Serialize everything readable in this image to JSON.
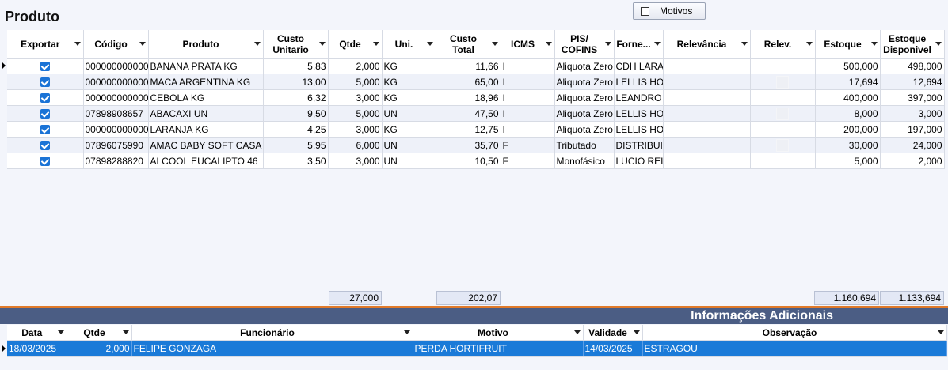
{
  "section_title": "Produto",
  "motivos_button": "Motivos",
  "columns": [
    "Exportar",
    "Código",
    "Produto",
    "Custo\nUnitario",
    "Qtde",
    "Uni.",
    "Custo\nTotal",
    "ICMS",
    "PIS/\nCOFINS",
    "Forne...",
    "Relevância",
    "Relev.",
    "Estoque",
    "Estoque\nDisponivel"
  ],
  "rows": [
    {
      "export": true,
      "codigo": "0000000000000",
      "produto": "BANANA PRATA KG",
      "custo_unit": "5,83",
      "qtde": "2,000",
      "uni": "KG",
      "custo_total": "11,66",
      "icms": "I",
      "pis": "Aliquota Zero",
      "forne": "CDH LARANJA",
      "relevancia": "",
      "relev_box": false,
      "estoque": "500,000",
      "disp": "498,000"
    },
    {
      "export": true,
      "codigo": "0000000000000",
      "produto": "MACA ARGENTINA KG",
      "custo_unit": "13,00",
      "qtde": "5,000",
      "uni": "KG",
      "custo_total": "65,00",
      "icms": "I",
      "pis": "Aliquota Zero",
      "forne": "LELLIS HORTI",
      "relevancia": "",
      "relev_box": true,
      "estoque": "17,694",
      "disp": "12,694"
    },
    {
      "export": true,
      "codigo": "0000000000000",
      "produto": "CEBOLA KG",
      "custo_unit": "6,32",
      "qtde": "3,000",
      "uni": "KG",
      "custo_total": "18,96",
      "icms": "I",
      "pis": "Aliquota Zero",
      "forne": "LEANDRO HORTI",
      "relevancia": "",
      "relev_box": false,
      "estoque": "400,000",
      "disp": "397,000"
    },
    {
      "export": true,
      "codigo": "07898908657",
      "produto": "ABACAXI UN",
      "custo_unit": "9,50",
      "qtde": "5,000",
      "uni": "UN",
      "custo_total": "47,50",
      "icms": "I",
      "pis": "Aliquota Zero",
      "forne": "LELLIS HORTI",
      "relevancia": "",
      "relev_box": true,
      "estoque": "8,000",
      "disp": "3,000"
    },
    {
      "export": true,
      "codigo": "0000000000000",
      "produto": "LARANJA KG",
      "custo_unit": "4,25",
      "qtde": "3,000",
      "uni": "KG",
      "custo_total": "12,75",
      "icms": "I",
      "pis": "Aliquota Zero",
      "forne": "LELLIS HORTI",
      "relevancia": "",
      "relev_box": false,
      "estoque": "200,000",
      "disp": "197,000"
    },
    {
      "export": true,
      "codigo": "07896075990",
      "produto": "AMAC BABY SOFT CASA",
      "custo_unit": "5,95",
      "qtde": "6,000",
      "uni": "UN",
      "custo_total": "35,70",
      "icms": "F",
      "pis": "Tributado",
      "forne": "DISTRIBUIDORA",
      "relevancia": "",
      "relev_box": true,
      "estoque": "30,000",
      "disp": "24,000"
    },
    {
      "export": true,
      "codigo": "07898288820",
      "produto": "ALCOOL EUCALIPTO 46",
      "custo_unit": "3,50",
      "qtde": "3,000",
      "uni": "UN",
      "custo_total": "10,50",
      "icms": "F",
      "pis": "Monofásico",
      "forne": "LUCIO REIS",
      "relevancia": "",
      "relev_box": false,
      "estoque": "5,000",
      "disp": "2,000"
    }
  ],
  "totals": {
    "qtde": "27,000",
    "custo_total": "202,07",
    "estoque": "1.160,694",
    "disp": "1.133,694"
  },
  "info_title": "Informações Adicionais",
  "info_columns": [
    "Data",
    "Qtde",
    "Funcionário",
    "Motivo",
    "Validade",
    "Observação"
  ],
  "info_rows": [
    {
      "data": "18/03/2025",
      "qtde": "2,000",
      "funcionario": "FELIPE GONZAGA",
      "motivo": "PERDA HORTIFRUIT",
      "validade": "14/03/2025",
      "obs": "ESTRAGOU"
    }
  ],
  "colors": {
    "accent": "#1a7ad8",
    "header_bar": "#4b5d84",
    "separator": "#e07a2a"
  }
}
